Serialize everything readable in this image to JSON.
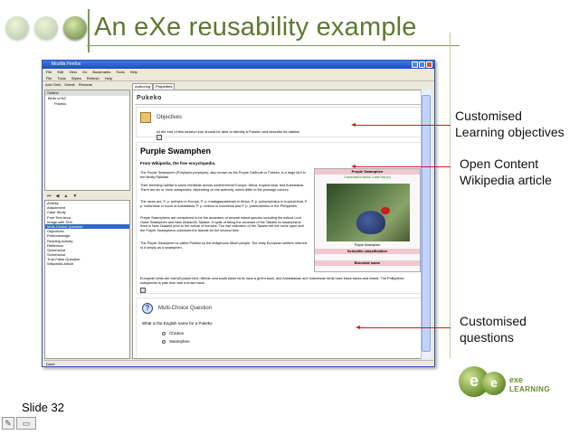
{
  "slide": {
    "title": "An eXe reusability example",
    "slide_number": "Slide 32",
    "logo": {
      "line1": "exe",
      "line2": "LEARNING",
      "mark_left": "e",
      "mark_right": "e"
    },
    "annotations": [
      {
        "text": "Customised\nLearning objectives"
      },
      {
        "text": "Open Content\nWikipedia article"
      },
      {
        "text": "Customised\nquestions"
      }
    ]
  },
  "window": {
    "title": "Mozilla Firefox",
    "menu1": [
      "File",
      "Edit",
      "View",
      "Go",
      "Bookmarks",
      "Tools",
      "Help"
    ],
    "menu2": [
      "File",
      "Tools",
      "Styles",
      "Refresh",
      "Help"
    ],
    "toolbar": [
      "Add Child",
      "Delete",
      "Rename"
    ],
    "outline": {
      "header": "Outline",
      "items": [
        "Birds of NZ"
      ],
      "subitems": [
        "Pukeko"
      ]
    },
    "idevices": [
      "Activity",
      "Attachment",
      "Case Study",
      "Free Text Area",
      "Image with Text",
      "Multi-Choice Question",
      "Objectives",
      "Preknowledge",
      "Reading Activity",
      "Reflection",
      "Screenshot",
      "Screenshot",
      "True-False Question",
      "Wikipedia Article"
    ],
    "selected_idevice_index": 5,
    "status": "Done",
    "tabs": [
      "Authoring",
      "Properties"
    ],
    "page_title": "Pukeko"
  },
  "objectives": {
    "title": "Objectives",
    "text": "At the end of this session you should be able to identify a Pukeko and describe its habitat"
  },
  "article": {
    "heading": "Purple Swamphen",
    "subheading": "From Wikipedia, the free encyclopedia.",
    "paragraphs": [
      "The Purple Swamphen (Porphyrio porphyrio), also known as the Purple Gallinule or Pukeko, is a large bird in the family Rallidae.",
      "Their breeding habitat is warm reedbeds across southernmost Europe, Africa, tropical Asia, and Australasia. There are six or more subspecies, depending on the authority, which differ in the plumage colours.",
      "The races are; P. p. porhyrio in Europe, P. p. madagascariensis in Africa, P. p. poliocephalus in tropical Asia, P. p. melanotus in much of Australasia, P. p. indicus in Indonesia and P. p. pulverulentus in the Philippines.",
      "Purple Swamphens are considered to be the ancestors of several island species including the extinct Lord Howe Swamphen and New Zealand's Takahe. In spite of being the ancestor of the Takahe no swamphens lived in New Zealand prior to the arrival of humans. The rise extinction of the Takahe left the niche open and the Purple Swamphens colonised the islands for the second time.",
      "The Purple Swamphen is called Pukeko by the indigenous Maori people. The early European settlers referred to it simply as a swamphen.",
      "European birds are overall purple-blue, African and south Asian birds have a green back, and Australasian and Indonesian birds have black backs and heads. The Philippines subspecies is pale blue with a brown back."
    ],
    "infobox": {
      "title": "Purple Swamphen",
      "status": "Conservation status: Lower risk (lc)",
      "caption": "Purple Swamphen",
      "classification": "Scientific classification",
      "binomial": "Binomial name"
    }
  },
  "mcq": {
    "title": "Multi-Choice Question",
    "question": "What is the English name for a Pukeko",
    "options": [
      "Chicken",
      "Swamphen"
    ]
  },
  "colors": {
    "title_green": "#5b7a2e",
    "arrow_red": "#cc1c1c",
    "selection_blue": "#316ac5"
  }
}
